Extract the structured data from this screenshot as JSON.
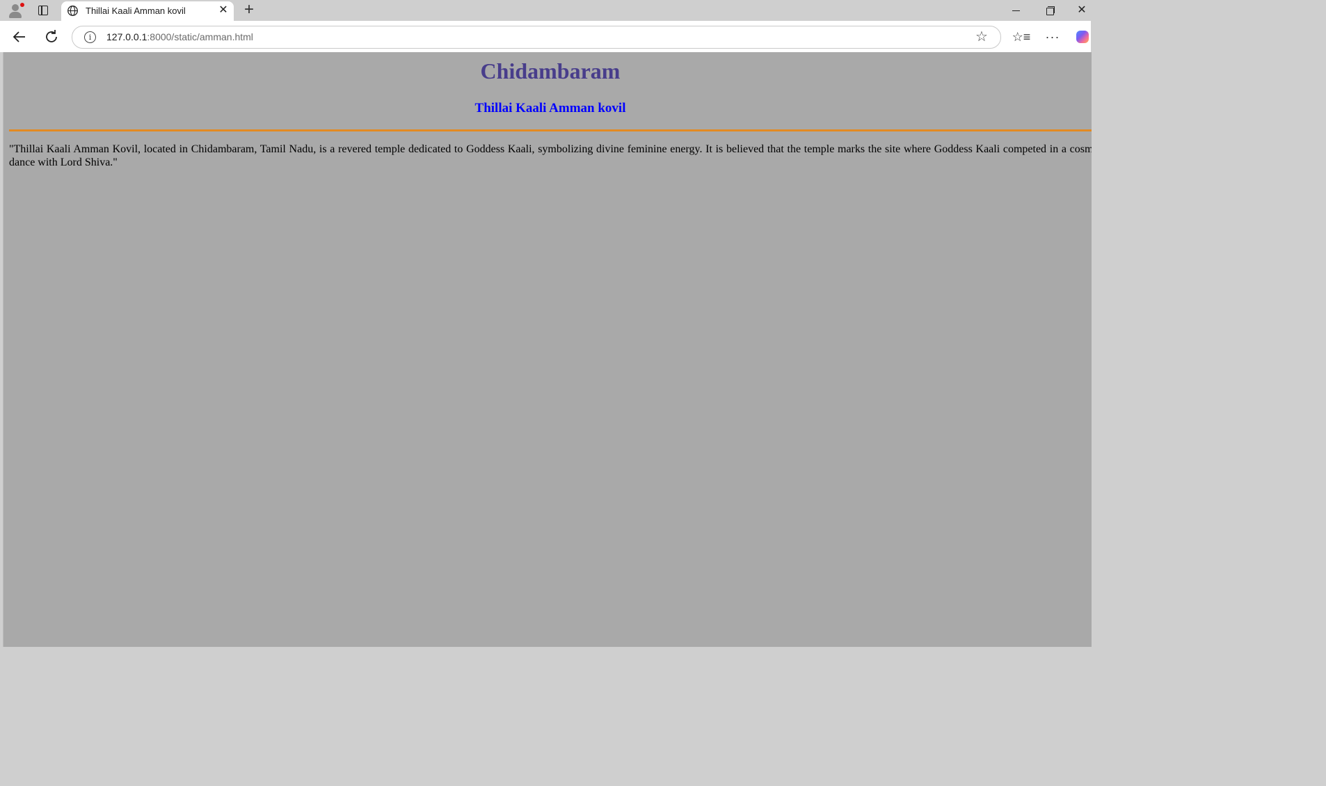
{
  "browser": {
    "tab_title": "Thillai Kaali Amman kovil",
    "url_host": "127.0.0.1",
    "url_rest": ":8000/static/amman.html"
  },
  "page": {
    "heading": "Chidambaram",
    "subheading": "Thillai Kaali Amman kovil",
    "paragraph": "\"Thillai Kaali Amman Kovil, located in Chidambaram, Tamil Nadu, is a revered temple dedicated to Goddess Kaali, symbolizing divine feminine energy. It is believed that the temple marks the site where Goddess Kaali competed in a cosmic dance with Lord Shiva.\"",
    "colors": {
      "background": "#a9a9a9",
      "heading": "#483d8b",
      "subheading": "#0000ff",
      "rule": "#e38a22"
    }
  }
}
